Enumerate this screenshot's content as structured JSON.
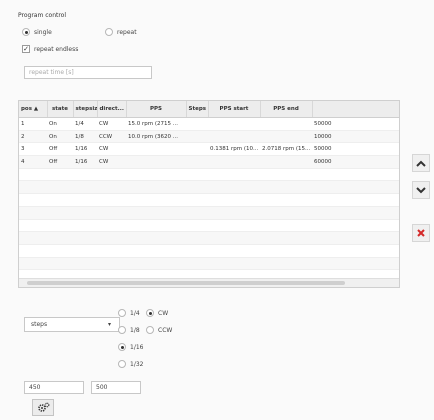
{
  "program_control": {
    "title": "Program control",
    "mode_single": "single",
    "mode_repeat": "repeat",
    "repeat_endless": "repeat endless",
    "repeat_time_placeholder": "repeat time [s]"
  },
  "table": {
    "headers": [
      "pos ▲",
      "state",
      "stepsize",
      "direct...",
      "PPS",
      "Steps",
      "PPS start",
      "PPS end",
      ""
    ],
    "rows": [
      [
        "1",
        "On",
        "1/4",
        "CW",
        "15.0 rpm (2715 ...",
        "",
        "",
        "",
        "50000"
      ],
      [
        "2",
        "On",
        "1/8",
        "CCW",
        "10.0 rpm (3620 ...",
        "",
        "",
        "",
        "10000"
      ],
      [
        "3",
        "Off",
        "1/16",
        "CW",
        "",
        "",
        "0.1381 rpm (10...",
        "2.0718 rpm (15...",
        "50000"
      ],
      [
        "4",
        "Off",
        "1/16",
        "CW",
        "",
        "",
        "",
        "",
        "60000"
      ]
    ],
    "empty_rows": 9
  },
  "side_buttons": {
    "up": "⌃",
    "down": "⌄",
    "delete": "✖"
  },
  "editor": {
    "unit_select_value": "steps",
    "stepsize_options": [
      "1/4",
      "1/8",
      "1/16",
      "1/32"
    ],
    "stepsize_selected": "1/16",
    "direction_options": [
      "CW",
      "CCW"
    ],
    "direction_selected": "CW",
    "value_field_1": "450",
    "value_field_2": "500"
  },
  "colors": {
    "delete": "#d42a2a",
    "gear": "#3a3a3a"
  }
}
